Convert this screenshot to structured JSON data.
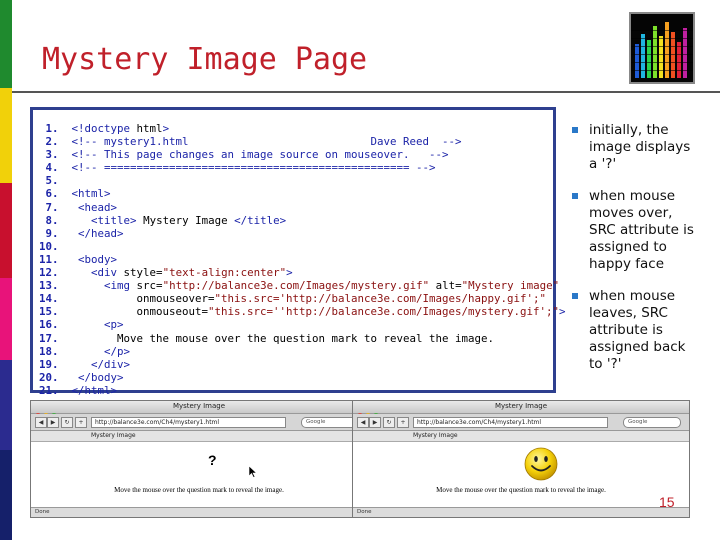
{
  "slide": {
    "title": "Mystery Image Page",
    "page_number": "15",
    "colors": {
      "title": "#c0202a",
      "accent_bar": [
        "#1f8a2e",
        "#f1d10a",
        "#c8102e",
        "#e8137a",
        "#7a2c8c",
        "#2b2b8f",
        "#15206a"
      ],
      "code_border": "#2e3f8f",
      "bullet_marker": "#2a78c8"
    }
  },
  "code": {
    "lines": [
      "<!doctype html>",
      "<!-- mystery1.html                            Dave Reed  -->",
      "<!-- This page changes an image source on mouseover.   -->",
      "<!-- =============================================== -->",
      "",
      "<html>",
      " <head>",
      "   <title> Mystery Image </title>",
      " </head>",
      "",
      " <body>",
      "   <div style=\"text-align:center\">",
      "     <img src=\"http://balance3e.com/Images/mystery.gif\" alt=\"Mystery image\"",
      "          onmouseover=\"this.src='http://balance3e.com/Images/happy.gif';\"",
      "          onmouseout=\"this.src=''http://balance3e.com/Images/mystery.gif';\">",
      "     <p>",
      "       Move the mouse over the question mark to reveal the image.",
      "     </p>",
      "   </div>",
      " </body>",
      "</html>"
    ]
  },
  "bullets": [
    "initially, the image displays a '?'",
    "when mouse moves over, SRC attribute is assigned to happy face",
    "when mouse leaves, SRC attribute is assigned back to '?'"
  ],
  "screenshots": [
    {
      "window_title": "Mystery Image",
      "url": "http://balance3e.com/Ch4/mystery1.html",
      "search_placeholder": "Google",
      "tab_label": "Mystery Image",
      "image_text": "?",
      "message": "Move the mouse over the question mark to reveal the image.",
      "status": "Done"
    },
    {
      "window_title": "Mystery Image",
      "url": "http://balance3e.com/Ch4/mystery1.html",
      "search_placeholder": "Google",
      "tab_label": "Mystery Image",
      "message": "Move the mouse over the question mark to reveal the image.",
      "status": "Done"
    }
  ]
}
